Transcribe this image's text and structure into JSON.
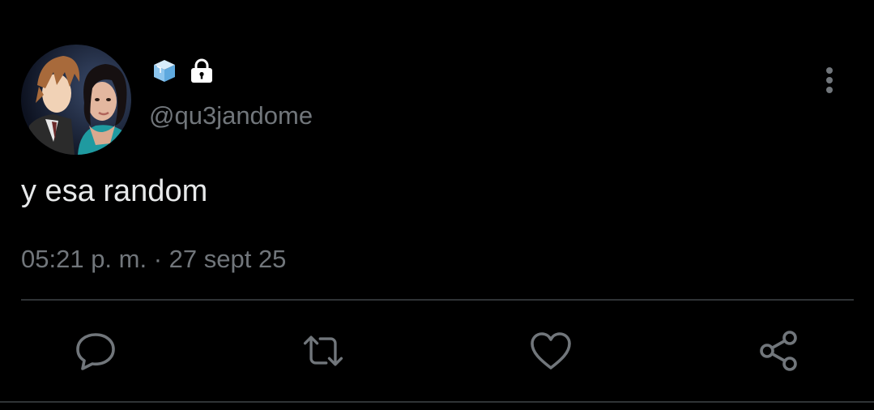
{
  "user": {
    "handle": "@qu3jandome",
    "name_emojis": [
      "ice-cube-emoji",
      "lock-icon"
    ]
  },
  "tweet": {
    "text": "y esa random",
    "timestamp": "05:21 p. m. · 27 sept 25"
  },
  "actions": [
    {
      "icon": "reply-icon"
    },
    {
      "icon": "retweet-icon"
    },
    {
      "icon": "heart-icon"
    },
    {
      "icon": "share-icon"
    }
  ],
  "colors": {
    "background": "#000000",
    "text": "#e7e9ea",
    "secondary": "#71767b",
    "divider": "#2f3336"
  }
}
